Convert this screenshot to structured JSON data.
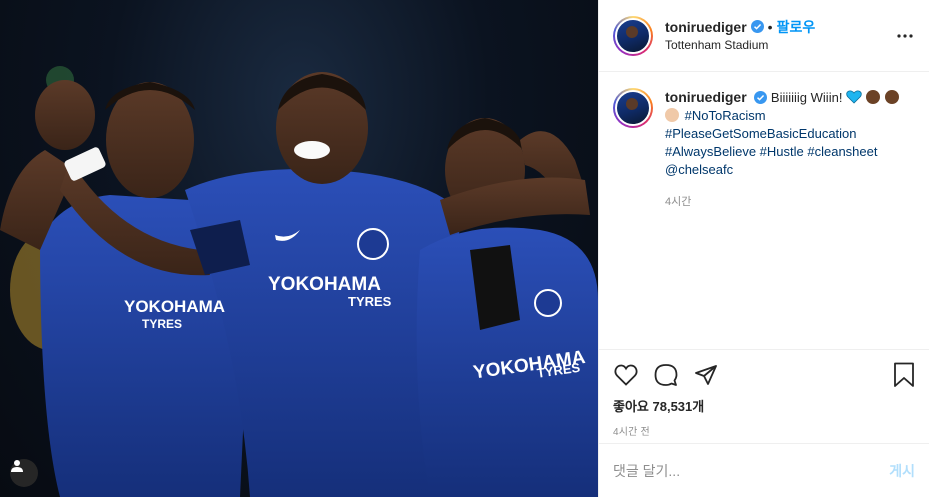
{
  "photo": {
    "sponsor_text": "YOKOHAMA",
    "sponsor_sub": "TYRES",
    "user_tag_icon": "user-icon"
  },
  "header": {
    "username": "toniruediger",
    "separator": "•",
    "follow_label": "팔로우",
    "location": "Tottenham Stadium",
    "more_icon": "more-options-icon"
  },
  "caption": {
    "username": "toniruediger",
    "text": "Biiiiiiig Wiiin!",
    "hashtag_1": "#NoToRacism",
    "hashtag_2": "#PleaseGetSomeBasicEducation",
    "hashtag_3": "#AlwaysBelieve",
    "hashtag_4": "#Hustle",
    "hashtag_5": "#cleansheet",
    "mention": "@chelseafc",
    "time": "4시간"
  },
  "actions": {
    "likes_text": "좋아요 78,531개",
    "posted": "4시간 전"
  },
  "comment": {
    "placeholder": "댓글 달기...",
    "post_label": "게시"
  },
  "colors": {
    "link": "#00376b",
    "follow": "#0095f6",
    "post_disabled": "#b2dffc",
    "verified": "#3897f0",
    "jersey": "#1f3f9c"
  }
}
